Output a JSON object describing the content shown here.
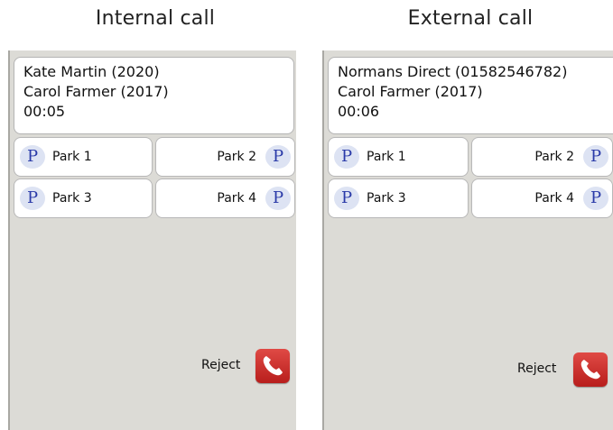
{
  "captions": {
    "left": "Internal call",
    "right": "External call"
  },
  "internal_call": {
    "caller": "Kate Martin (2020)",
    "callee": "Carol Farmer (2017)",
    "duration": "00:05",
    "parks": [
      "Park 1",
      "Park 2",
      "Park 3",
      "Park 4"
    ],
    "reject_label": "Reject"
  },
  "external_call": {
    "caller": "Normans Direct (01582546782)",
    "callee": "Carol Farmer (2017)",
    "duration": "00:06",
    "parks": [
      "Park 1",
      "Park 2",
      "Park 3",
      "Park 4"
    ],
    "reject_label": "Reject"
  },
  "park_icon_glyph": "P",
  "colors": {
    "panel_bg": "#dcdbd6",
    "park_icon": "#2a3aa8",
    "reject_button": "#c8302c"
  }
}
